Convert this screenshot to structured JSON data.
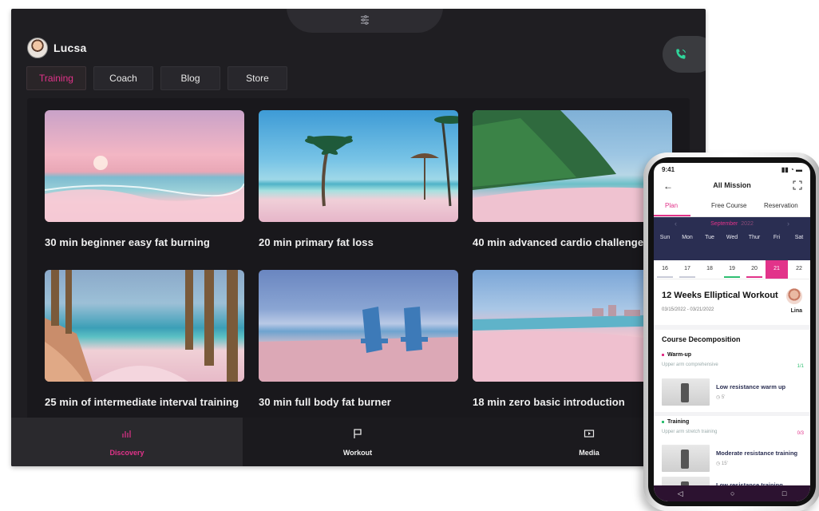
{
  "app": {
    "user_name": "Lucsa",
    "tabs": [
      {
        "label": "Training",
        "active": true
      },
      {
        "label": "Coach",
        "active": false
      },
      {
        "label": "Blog",
        "active": false
      },
      {
        "label": "Store",
        "active": false
      }
    ],
    "cards": [
      {
        "title": "30 min beginner easy fat burning"
      },
      {
        "title": "20 min primary fat loss"
      },
      {
        "title": "40 min advanced cardio challenge"
      },
      {
        "title": "25 min of intermediate interval training"
      },
      {
        "title": "30 min full body fat burner"
      },
      {
        "title": "18 min zero basic introduction"
      }
    ],
    "bottom_nav": [
      {
        "label": "Discovery",
        "icon": "discovery-icon",
        "active": true
      },
      {
        "label": "Workout",
        "icon": "flag-icon",
        "active": false
      },
      {
        "label": "Media",
        "icon": "film-icon",
        "active": false
      }
    ],
    "accent_color": "#e2338a",
    "call_icon_color": "#2fd59a"
  },
  "phone": {
    "time": "9:41",
    "header_title": "All Mission",
    "tabs": [
      {
        "label": "Plan",
        "active": true
      },
      {
        "label": "Free Course",
        "active": false
      },
      {
        "label": "Reservation",
        "active": false
      }
    ],
    "calendar": {
      "month": "September",
      "year": "2022",
      "days": [
        "Sun",
        "Mon",
        "Tue",
        "Wed",
        "Thur",
        "Fri",
        "Sat"
      ],
      "dates": [
        "16",
        "17",
        "18",
        "19",
        "20",
        "21",
        "22"
      ],
      "selected_date": "21"
    },
    "course": {
      "title": "12 Weeks Elliptical Workout",
      "dates": "03/15/2022 - 03/21/2022",
      "coach_name": "Lina"
    },
    "section_title": "Course Decomposition",
    "groups": [
      {
        "label": "Warm-up",
        "subtitle": "Upper arm comprehensive",
        "count": "1/1",
        "dot_color": "#e2338a",
        "count_color": "#2fbf71",
        "items": [
          {
            "title": "Low resistance warm up",
            "duration": "5'"
          }
        ]
      },
      {
        "label": "Training",
        "subtitle": "Upper arm stretch training",
        "count": "0/3",
        "dot_color": "#2fbf71",
        "count_color": "#e2338a",
        "items": [
          {
            "title": "Moderate resistance training",
            "duration": "15'"
          },
          {
            "title": "Low resistance training",
            "duration": ""
          }
        ]
      }
    ]
  }
}
